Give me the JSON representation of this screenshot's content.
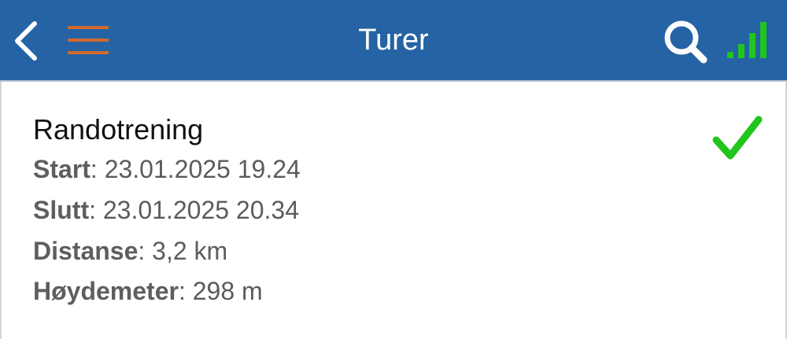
{
  "header": {
    "title": "Turer",
    "back_icon": "chevron-left-icon",
    "menu_icon": "hamburger-menu-icon",
    "search_icon": "search-icon",
    "signal_icon": "signal-strength-icon",
    "colors": {
      "bar_background": "#2563a5",
      "menu_icon": "#d2692f",
      "signal_icon": "#22c51e",
      "title": "#ffffff"
    }
  },
  "tour": {
    "name": "Randotrening",
    "status_icon": "checkmark-icon",
    "status_color": "#22c51e",
    "details": [
      {
        "label": "Start",
        "separator": ": ",
        "value": "23.01.2025 19.24"
      },
      {
        "label": "Slutt",
        "separator": ": ",
        "value": "23.01.2025 20.34"
      },
      {
        "label": "Distanse",
        "separator": ": ",
        "value": "3,2 km"
      },
      {
        "label": "Høydemeter",
        "separator": ": ",
        "value": "298 m"
      }
    ]
  }
}
